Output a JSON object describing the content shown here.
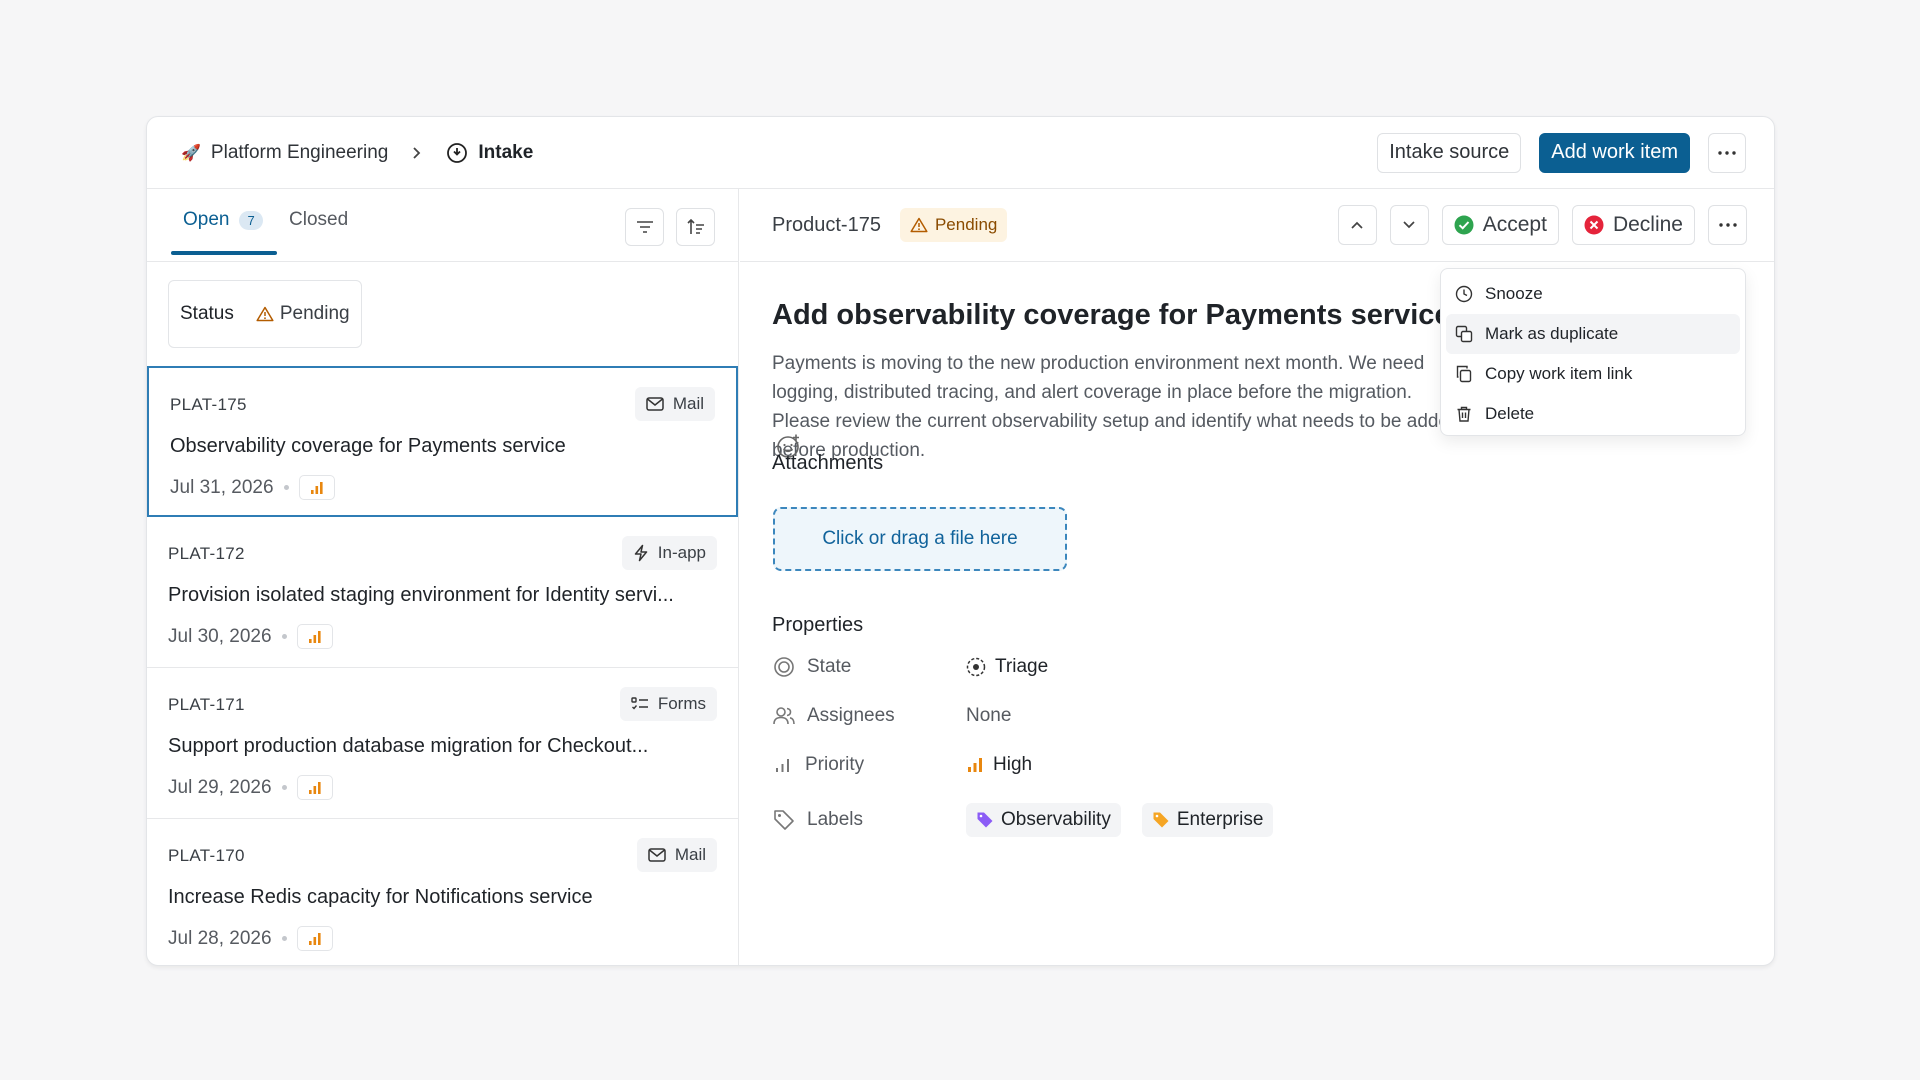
{
  "header": {
    "workspace": "Platform Engineering",
    "current": "Intake",
    "intake_source_label": "Intake source",
    "add_work_item_label": "Add work item"
  },
  "left": {
    "tabs": {
      "open_label": "Open",
      "open_count": "7",
      "closed_label": "Closed"
    },
    "filter": {
      "label": "Status",
      "value": "Pending"
    },
    "items": [
      {
        "id": "PLAT-175",
        "source": "Mail",
        "title": "Observability coverage for Payments service",
        "date": "Jul 31, 2026"
      },
      {
        "id": "PLAT-172",
        "source": "In-app",
        "title": "Provision isolated staging environment for Identity servi...",
        "date": "Jul 30, 2026"
      },
      {
        "id": "PLAT-171",
        "source": "Forms",
        "title": "Support production database migration for Checkout...",
        "date": "Jul 29, 2026"
      },
      {
        "id": "PLAT-170",
        "source": "Mail",
        "title": "Increase Redis capacity for Notifications service",
        "date": "Jul 28, 2026"
      }
    ]
  },
  "detail": {
    "id": "Product-175",
    "status": "Pending",
    "accept_label": "Accept",
    "decline_label": "Decline",
    "title": "Add observability coverage for Payments service",
    "description": "Payments is moving to the new production environment next month. We need logging, distributed tracing, and alert coverage in place before the migration. Please review the current observability setup and identify what needs to be added before production.",
    "attachments_heading": "Attachments",
    "dropzone_text": "Click or drag a file here",
    "properties_heading": "Properties",
    "properties": {
      "state_label": "State",
      "state_value": "Triage",
      "assignees_label": "Assignees",
      "assignees_value": "None",
      "priority_label": "Priority",
      "priority_value": "High",
      "labels_label": "Labels",
      "labels": [
        "Observability",
        "Enterprise"
      ]
    }
  },
  "menu": {
    "items": [
      "Snooze",
      "Mark as duplicate",
      "Copy work item link",
      "Delete"
    ]
  },
  "colors": {
    "accent": "#0b5f92",
    "pending": "#b35c00",
    "accept": "#2ea44f",
    "decline": "#e5243b",
    "priority": "#e8870f",
    "label_observability": "#8b5cf6",
    "label_enterprise": "#f5a524"
  }
}
